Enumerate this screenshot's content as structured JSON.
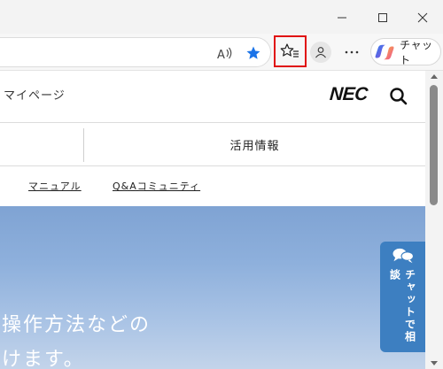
{
  "browser": {
    "copilot_label": "チャット"
  },
  "header": {
    "mypage": "マイページ",
    "logo": "NEC"
  },
  "nav": {
    "item": "活用情報"
  },
  "sublinks": [
    {
      "label": "マニュアル"
    },
    {
      "label": "Q&Aコミュニティ"
    }
  ],
  "hero": {
    "line1": "操作方法などの",
    "line2": "けます。"
  },
  "chat_tab": {
    "label": "チャットで相談"
  },
  "colors": {
    "highlight": "#e01010",
    "favorite_star": "#1a73e8",
    "chat_tab": "#3d7fc1"
  }
}
